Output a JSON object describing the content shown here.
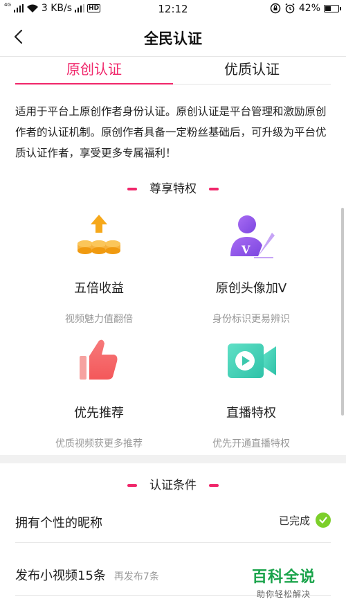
{
  "status_bar": {
    "network_type": "4G",
    "speed": "3 KB/s",
    "time": "12:12",
    "battery": "42%",
    "battery_level": 0.42
  },
  "nav": {
    "title": "全民认证"
  },
  "tabs": [
    {
      "label": "原创认证",
      "active": true
    },
    {
      "label": "优质认证",
      "active": false
    }
  ],
  "description": "适用于平台上原创作者身份认证。原创认证是平台管理和激励原创作者的认证机制。原创作者具备一定粉丝基础后，可升级为平台优质认证作者，享受更多专属福利！",
  "privileges": {
    "title": "尊享特权",
    "items": [
      {
        "title": "五倍收益",
        "subtitle": "视频魅力值翻倍",
        "icon": "coins-arrow-icon"
      },
      {
        "title": "原创头像加V",
        "subtitle": "身份标识更易辨识",
        "icon": "avatar-v-icon"
      },
      {
        "title": "优先推荐",
        "subtitle": "优质视频获更多推荐",
        "icon": "thumbs-up-icon"
      },
      {
        "title": "直播特权",
        "subtitle": "优先开通直播特权",
        "icon": "video-camera-icon"
      }
    ]
  },
  "conditions": {
    "title": "认证条件",
    "items": [
      {
        "label": "拥有个性的昵称",
        "status": "已完成",
        "completed": true
      },
      {
        "label": "发布小视频15条",
        "sub": "再发布7条",
        "completed": false
      }
    ]
  },
  "watermark": {
    "main": "百科全说",
    "sub": "助你轻松解决"
  },
  "colors": {
    "accent": "#f0266a",
    "check_green": "#7ccf2a",
    "watermark_green": "#19a34a"
  }
}
